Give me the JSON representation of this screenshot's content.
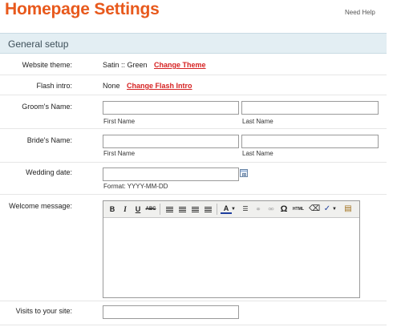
{
  "header": {
    "title": "Homepage Settings",
    "help_label": "Need Help"
  },
  "section": {
    "title": "General setup"
  },
  "fields": {
    "theme": {
      "label": "Website theme:",
      "value": "Satin :: Green",
      "link": "Change Theme"
    },
    "flash": {
      "label": "Flash intro:",
      "value": "None",
      "link": "Change Flash Intro"
    },
    "groom": {
      "label": "Groom's Name:",
      "first_hint": "First Name",
      "last_hint": "Last Name",
      "first_value": "",
      "last_value": ""
    },
    "bride": {
      "label": "Bride's Name:",
      "first_hint": "First Name",
      "last_hint": "Last Name",
      "first_value": "",
      "last_value": ""
    },
    "wedding_date": {
      "label": "Wedding date:",
      "value": "",
      "format_hint": "Format: YYYY-MM-DD"
    },
    "welcome": {
      "label": "Welcome message:",
      "toolbar": {
        "bold": "B",
        "italic": "I",
        "underline": "U",
        "strike": "ABC",
        "font_color": "A",
        "omega": "Ω",
        "html": "HTML"
      }
    },
    "visits": {
      "label": "Visits to your site:",
      "value": ""
    }
  },
  "colors": {
    "title": "#e8591c",
    "link": "#d62222",
    "section_bg": "#e3eef3"
  },
  "icons": {
    "calendar": "calendar-icon",
    "align_left": "align-left-icon",
    "align_center": "align-center-icon",
    "align_right": "align-right-icon",
    "align_justify": "align-justify-icon",
    "bullet_list": "bullet-list-icon",
    "link": "link-icon",
    "unlink": "unlink-icon",
    "eraser": "eraser-icon",
    "spellcheck": "spellcheck-icon",
    "paste": "paste-icon"
  }
}
